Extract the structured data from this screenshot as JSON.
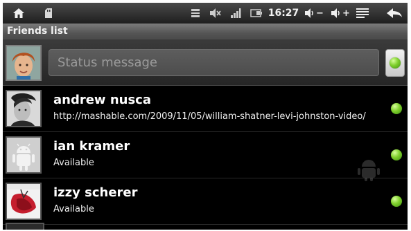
{
  "status_bar": {
    "time": "16:27",
    "volume_down_label": "−",
    "volume_up_label": "+",
    "icons": [
      "home-icon",
      "sd-card-icon",
      "usb-icon",
      "mute-icon",
      "signal-icon",
      "battery-icon",
      "volume-down-icon",
      "volume-up-icon",
      "menu-icon",
      "back-icon"
    ]
  },
  "title_bar": {
    "title": "Friends list"
  },
  "composer": {
    "placeholder": "Status message",
    "presence_color": "#7fcf2c"
  },
  "friends": [
    {
      "name": "andrew nusca",
      "status": "http://mashable.com/2009/11/05/william-shatner-levi-johnston-video/",
      "avatar": "photo-portrait"
    },
    {
      "name": "ian kramer",
      "status": "Available",
      "avatar": "android-default"
    },
    {
      "name": "izzy scherer",
      "status": "Available",
      "avatar": "photo-red-album"
    }
  ],
  "colors": {
    "online": "#7fcf2c",
    "background": "#000000",
    "titlebar": "#555555"
  }
}
